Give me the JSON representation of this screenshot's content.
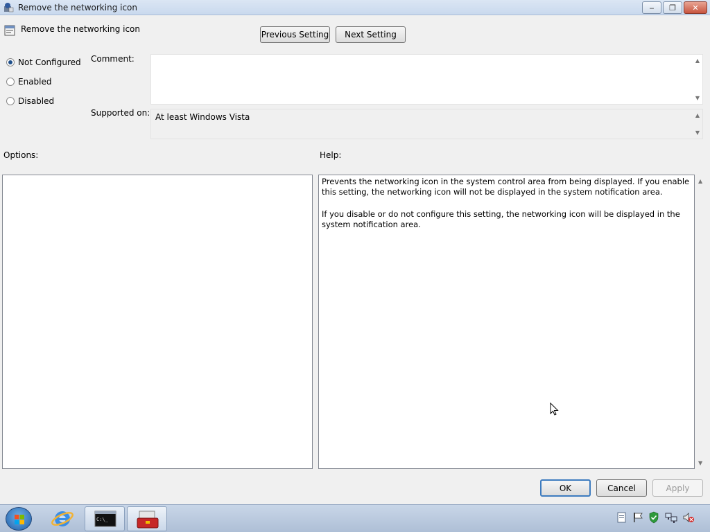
{
  "window": {
    "title": "Remove the networking icon",
    "minimize_glyph": "‒",
    "maximize_glyph": "❐",
    "close_glyph": "✕"
  },
  "header": {
    "setting_title": "Remove the networking icon",
    "prev_button": "Previous Setting",
    "next_button": "Next Setting"
  },
  "state": {
    "options": [
      {
        "label": "Not Configured",
        "checked": true
      },
      {
        "label": "Enabled",
        "checked": false
      },
      {
        "label": "Disabled",
        "checked": false
      }
    ]
  },
  "comment": {
    "label": "Comment:",
    "value": ""
  },
  "supported": {
    "label": "Supported on:",
    "value": "At least Windows Vista"
  },
  "options_label": "Options:",
  "help": {
    "label": "Help:",
    "paragraphs": [
      "Prevents the networking icon in the system control area from being displayed. If you enable this setting, the networking icon will not be displayed in the system notification area.",
      "If you disable or do not configure this setting, the networking icon will be displayed in the system notification area."
    ]
  },
  "footer": {
    "ok": "OK",
    "cancel": "Cancel",
    "apply": "Apply"
  },
  "taskbar": {
    "items": [
      "start-orb",
      "internet-explorer-icon",
      "command-prompt-icon",
      "toolbox-icon"
    ],
    "cmd_text": "C:\\_",
    "tray_icons": [
      "document-icon",
      "flag-icon",
      "shield-check-icon",
      "network-icon",
      "volume-muted-icon"
    ]
  },
  "colors": {
    "accent": "#3d7bbf",
    "title_bar": "#c9d9ee",
    "taskbar": "#aebfd6"
  }
}
